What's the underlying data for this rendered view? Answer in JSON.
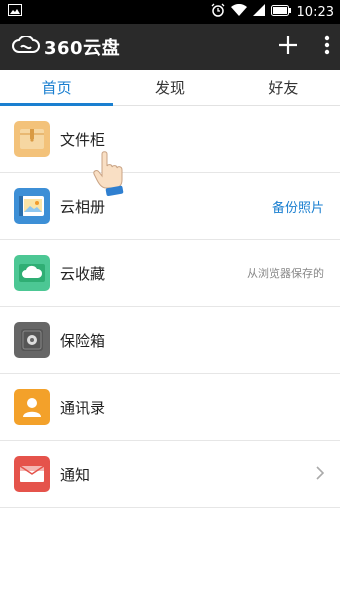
{
  "status": {
    "time": "10:23"
  },
  "app": {
    "title": "360云盘"
  },
  "tabs": [
    {
      "label": "首页",
      "active": true
    },
    {
      "label": "发现",
      "active": false
    },
    {
      "label": "好友",
      "active": false
    }
  ],
  "items": [
    {
      "label": "文件柜",
      "extra": "",
      "icon": "folder-icon",
      "color": "#f3c27a"
    },
    {
      "label": "云相册",
      "extra": "备份照片",
      "icon": "photo-album-icon",
      "color": "#3d8fd6"
    },
    {
      "label": "云收藏",
      "extra": "从浏览器保存的",
      "icon": "cloud-icon",
      "color": "#4cc794"
    },
    {
      "label": "保险箱",
      "extra": "",
      "icon": "safe-icon",
      "color": "#666666"
    },
    {
      "label": "通讯录",
      "extra": "",
      "icon": "contacts-icon",
      "color": "#f3a12a"
    },
    {
      "label": "通知",
      "extra": "",
      "icon": "mail-icon",
      "color": "#e5534b"
    }
  ],
  "colors": {
    "accent": "#1a7fd0",
    "appbar": "#2a2a2a"
  }
}
